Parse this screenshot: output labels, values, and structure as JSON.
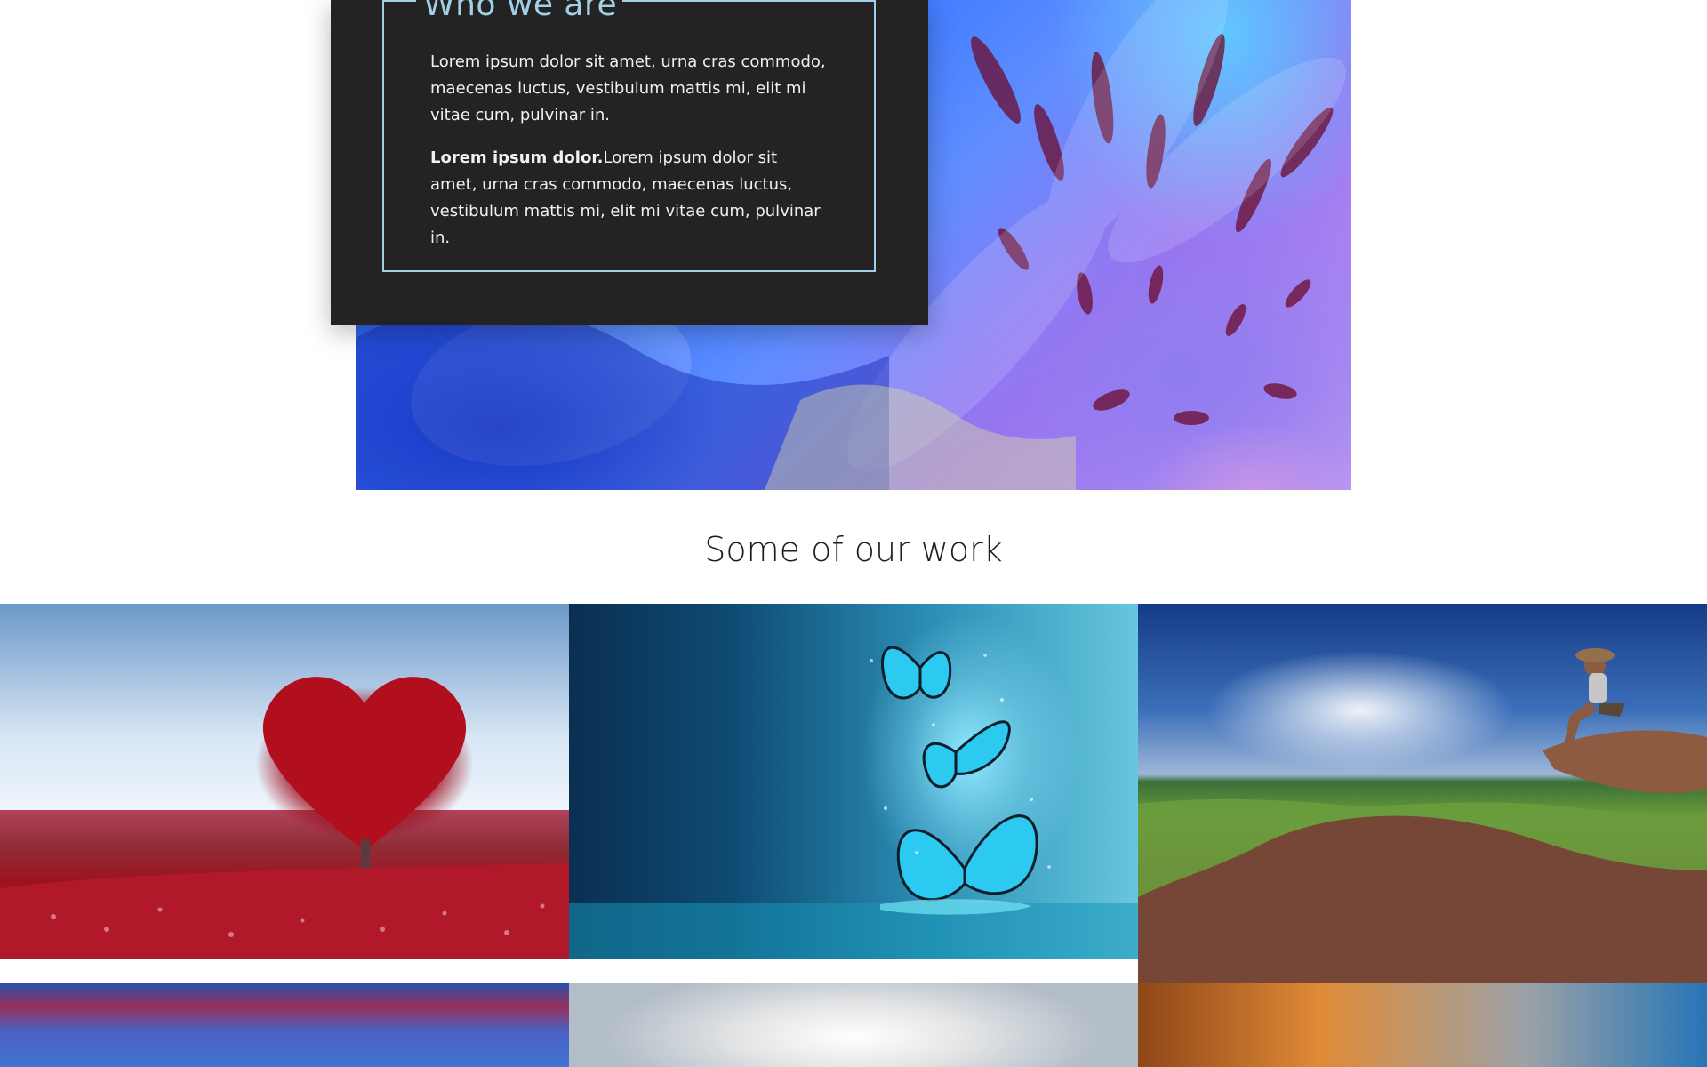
{
  "about": {
    "title": "Who we are",
    "paragraph_1": "Lorem ipsum dolor sit amet, urna cras commodo, maecenas luctus, vestibulum mattis mi, elit mi vitae cum, pulvinar in.",
    "paragraph_2_bold": "Lorem ipsum dolor.",
    "paragraph_2_rest": "Lorem ipsum dolor sit amet, urna cras commodo, maecenas luctus, vestibulum mattis mi, elit mi vitae cum, pulvinar in."
  },
  "work": {
    "heading": "Some of our work"
  },
  "colors": {
    "card_background": "#232323",
    "accent_border": "#9fd0e5",
    "page_background": "#ffffff"
  }
}
